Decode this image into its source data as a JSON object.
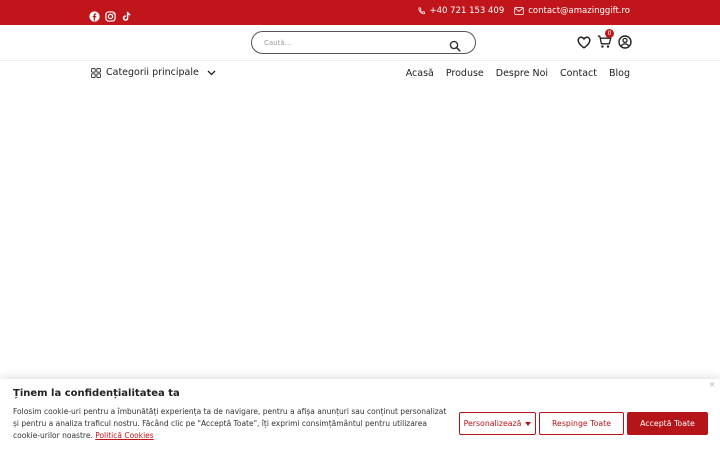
{
  "colors": {
    "brand": "#c0161b",
    "button": "#b51419",
    "topbar_text": "#ffffff"
  },
  "topbar": {
    "social_icons": [
      "facebook-icon",
      "instagram-icon",
      "tiktok-icon"
    ],
    "phone": "+40 721 153 409",
    "email": "contact@amazinggift.ro"
  },
  "header": {
    "search": {
      "placeholder": "Caută..."
    },
    "cart_count": "0",
    "icons": [
      "heart-icon",
      "cart-icon",
      "user-icon"
    ]
  },
  "nav": {
    "categories_label": "Categorii principale",
    "menu": [
      "Acasă",
      "Produse",
      "Despre Noi",
      "Contact",
      "Blog"
    ]
  },
  "cookie": {
    "title": "Ținem la confidențialitatea ta",
    "description": "Folosim cookie-uri pentru a îmbunătăți experiența ta de navigare, pentru a afișa anunțuri sau conținut personalizat și pentru a analiza traficul nostru. Făcând clic pe \"Acceptă Toate\", îți exprimi consimțământul pentru utilizarea cookie-urilor noastre.",
    "policy_link": "Politică Cookies",
    "customize": "Personalizează",
    "reject": "Respinge Toate",
    "accept": "Acceptă Toate"
  }
}
